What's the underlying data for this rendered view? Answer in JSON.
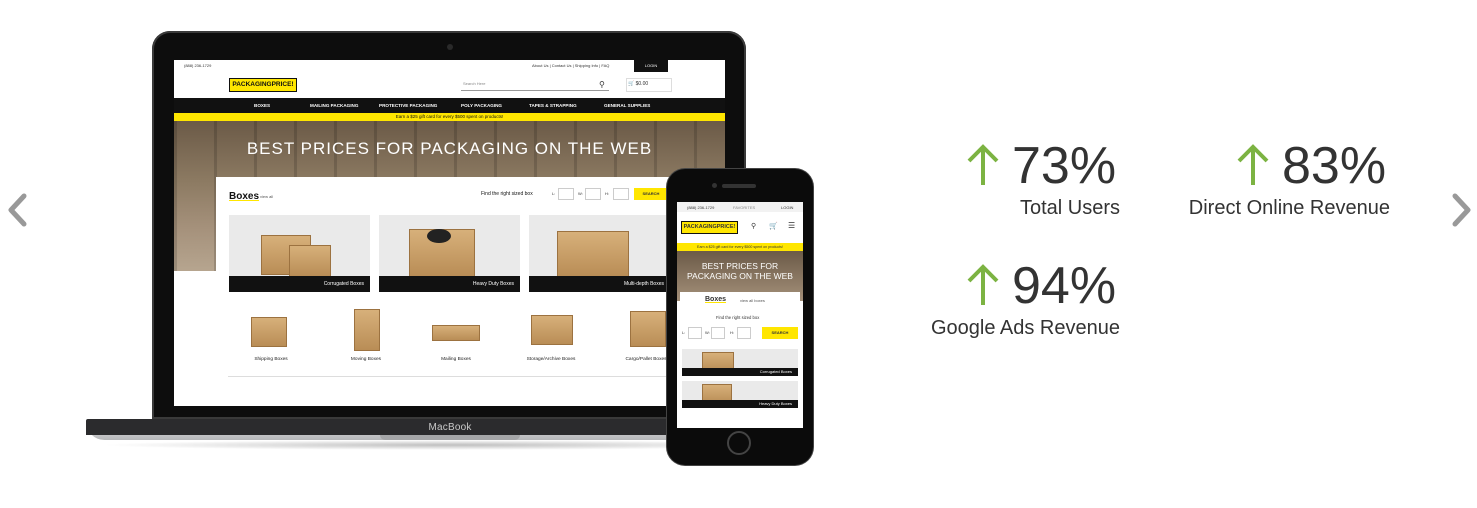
{
  "accent": {
    "arrow_green": "#7cb342",
    "brand_yellow": "#ffe600",
    "nav_black": "#111111"
  },
  "carousel": {
    "prev_icon": "chevron-left-icon",
    "next_icon": "chevron-right-icon"
  },
  "laptop": {
    "brand": "MacBook",
    "site": {
      "phone": "(888) 236-1729",
      "top_links": "About Us  |  Contact Us  |  Shipping Info  |  FAQ",
      "login": "LOGIN",
      "logo": "PACKAGINGPRICE!",
      "search_placeholder": "Search Here",
      "cart": "$0.00",
      "nav": [
        "BOXES",
        "MAILING PACKAGING",
        "PROTECTIVE PACKAGING",
        "POLY PACKAGING",
        "TAPES & STRAPPING",
        "GENERAL SUPPLIES"
      ],
      "promo": "Earn a $25 gift card for every $500 spent on products!",
      "hero_title": "BEST PRICES FOR PACKAGING ON THE WEB",
      "panel_title": "Boxes",
      "panel_viewall": "view all",
      "finder_label": "Find the right sized box",
      "finder_l": "L:",
      "finder_w": "W:",
      "finder_h": "H:",
      "finder_button": "SEARCH",
      "categories": [
        "Corrugated Boxes",
        "Heavy Duty Boxes",
        "Multi-depth Boxes"
      ],
      "small_categories": [
        "Shipping Boxes",
        "Moving Boxes",
        "Mailing Boxes",
        "Storage/Archive Boxes",
        "Cargo/Pallet Boxes"
      ]
    }
  },
  "phone": {
    "site": {
      "phone": "(888) 236-1729",
      "fav": "FAVORITES",
      "login": "LOGIN",
      "logo": "PACKAGINGPRICE!",
      "icons": [
        "search",
        "cart",
        "menu"
      ],
      "promo": "Earn a $25 gift card for every $500 spent on products!",
      "hero_title_1": "BEST PRICES FOR",
      "hero_title_2": "PACKAGING ON THE WEB",
      "panel_title": "Boxes",
      "panel_viewall": "view all boxes",
      "finder_label": "Find the right sized box",
      "finder_l": "L:",
      "finder_w": "W:",
      "finder_h": "H:",
      "finder_button": "SEARCH",
      "cards": [
        "Corrugated Boxes",
        "Heavy Duty Boxes"
      ]
    }
  },
  "stats": [
    {
      "value": "73%",
      "label": "Total Users"
    },
    {
      "value": "83%",
      "label": "Direct Online Revenue"
    },
    {
      "value": "94%",
      "label": "Google Ads Revenue"
    }
  ]
}
